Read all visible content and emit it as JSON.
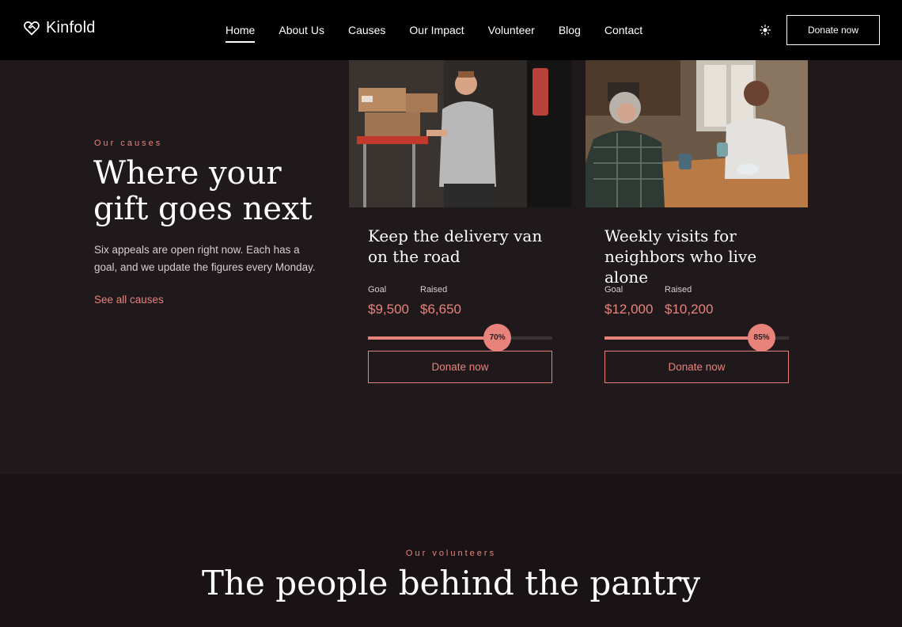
{
  "brand": {
    "name": "Kinfold",
    "accent": "#e8837c"
  },
  "nav": {
    "links": [
      "Home",
      "About Us",
      "Causes",
      "Our Impact",
      "Volunteer",
      "Blog",
      "Contact"
    ],
    "active": "Home",
    "donate_label": "Donate now"
  },
  "causes": {
    "eyebrow": "Our causes",
    "title_line1": "Where your",
    "title_line2": "gift goes next",
    "description": "Six appeals are open right now. Each has a goal, and we update the figures every Monday.",
    "see_all_label": "See all causes",
    "cards": [
      {
        "title": "Keep the delivery van on the road",
        "goal_label": "Goal",
        "goal_value": "$9,500",
        "raised_label": "Raised",
        "raised_value": "$6,650",
        "percent_label": "70%",
        "progress_fraction": 0.7,
        "donate_label": "Donate now"
      },
      {
        "title": "Weekly visits for neighbors who live alone",
        "goal_label": "Goal",
        "goal_value": "$12,000",
        "raised_label": "Raised",
        "raised_value": "$10,200",
        "percent_label": "85%",
        "progress_fraction": 0.85,
        "donate_label": "Donate now"
      }
    ]
  },
  "volunteers": {
    "eyebrow": "Our volunteers",
    "title": "The people behind the pantry"
  }
}
